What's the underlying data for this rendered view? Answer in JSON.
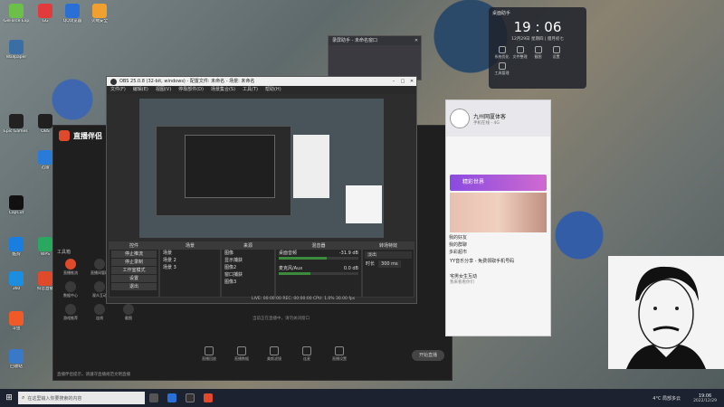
{
  "desktop_icons": [
    {
      "label": "GeForce Experience",
      "color": "#6cc04a"
    },
    {
      "label": "GG",
      "color": "#e23b3b"
    },
    {
      "label": "QQ浏览器",
      "color": "#2a6fd6"
    },
    {
      "label": "火绒安全",
      "color": "#f0a030"
    },
    {
      "label": "Wallpaper",
      "color": "#3a6ea5"
    },
    {
      "label": "Epic Games Launcher",
      "color": "#222222"
    },
    {
      "label": "迅雷",
      "color": "#2a7ad8"
    },
    {
      "label": "OBS",
      "color": "#202020"
    },
    {
      "label": "CapCut",
      "color": "#111111"
    },
    {
      "label": "酷狗",
      "color": "#1a7de0"
    },
    {
      "label": "WPS",
      "color": "#2aa860"
    },
    {
      "label": "抖音直播",
      "color": "#e04a2a"
    },
    {
      "label": "360",
      "color": "#1b8ee0"
    },
    {
      "label": "斗鱼",
      "color": "#f05a28"
    },
    {
      "label": "回收站",
      "color": "#3a78c8"
    }
  ],
  "clock_widget": {
    "title": "桌面助手",
    "time": "19 : 06",
    "date": "12月29日 星期四 | 腊月初七",
    "items": [
      "系统优化",
      "文件整理",
      "截图",
      "设置",
      "工具管理"
    ]
  },
  "small_window": {
    "title": "录屏助手 - 未命名窗口"
  },
  "obs": {
    "title": "OBS 25.0.8 (32-bit, windows) - 配置文件: 未命名 - 场景: 未命名",
    "menu": [
      "文件(F)",
      "编辑(E)",
      "视图(V)",
      "停靠部件(D)",
      "场景集合(S)",
      "工具(T)",
      "帮助(H)"
    ],
    "docks": {
      "control": {
        "header": "控件",
        "buttons": [
          "停止推流",
          "停止录制",
          "工作室模式",
          "设置",
          "退出"
        ]
      },
      "scenes": {
        "header": "场景",
        "items": [
          "场景",
          "场景 2",
          "场景 3"
        ]
      },
      "sources": {
        "header": "来源",
        "items": [
          "图像",
          "显示捕获",
          "图像2",
          "窗口捕获",
          "图像3"
        ]
      },
      "mixer": {
        "header": "混音器",
        "ch1": "桌面音频",
        "ch1_db": "-31.9 dB",
        "ch2": "麦克风/Aux",
        "ch2_db": "0.0 dB"
      },
      "transitions": {
        "header": "转场特效",
        "type": "淡出",
        "duration_label": "时长",
        "duration": "300 ms"
      }
    },
    "status": "LIVE: 00:00:00  REC: 00:00:00  CPU: 1.0%  30.00 fps"
  },
  "stream_app": {
    "title": "直播伴侣",
    "side_label": "工具箱",
    "tools": [
      "直播推流",
      "直播间管理",
      "工作室",
      "数据中心",
      "观众互动",
      "直播设置",
      "游戏推荐",
      "连线",
      "截图"
    ],
    "notice": "直播伴侣提示，请遵守直播规范文明直播",
    "bottom_icons": [
      "直播回放",
      "直播数据",
      "美颜滤镜",
      "连麦",
      "直播设置"
    ],
    "start_button": "开始直播",
    "hint": "当前正在直播中，请勿关闭窗口"
  },
  "qq_panel": {
    "name": "九州网厦体客",
    "status": "手机在线 - 4G",
    "banner": "精彩世界",
    "list": [
      "我的好友",
      "我的群聊",
      "多彩超市"
    ],
    "chat1": "YY音乐分享 - 免费领取手机号码",
    "chat2": "宅男女生互动",
    "chat2_sub": "我来看看你们"
  },
  "taskbar": {
    "search_placeholder": "在这里输入你要搜索的内容",
    "weather": "4°C 局部多云",
    "time": "19:06",
    "date": "2022/12/29"
  },
  "colors": {
    "accent": "#e04a2a",
    "obs_bg": "#2d2d2d",
    "taskbar": "#1c2230"
  }
}
